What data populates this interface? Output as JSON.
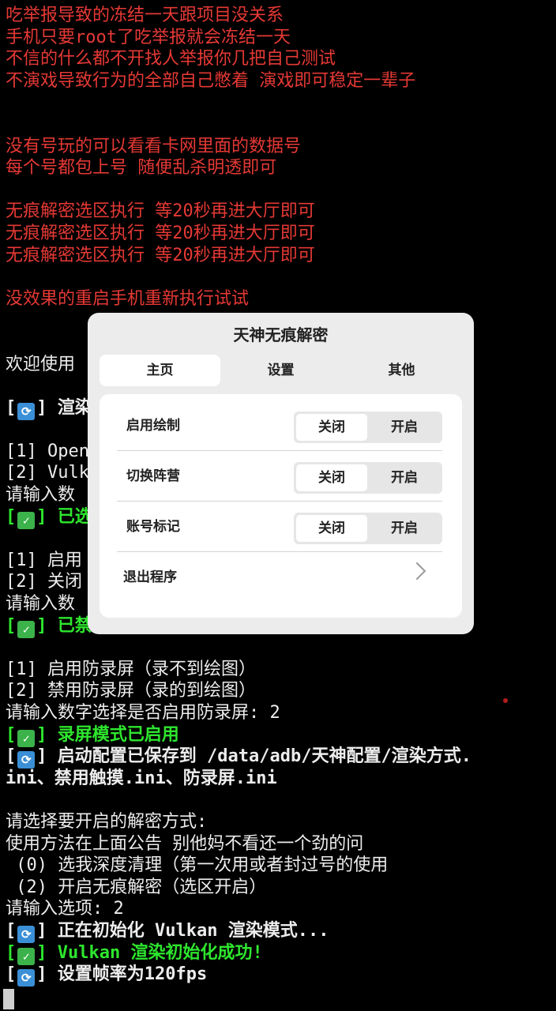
{
  "terminal": {
    "lines": [
      {
        "text": "吃举报导致的冻结一天跟项目没关系",
        "color": "red"
      },
      {
        "text": "手机只要root了吃举报就会冻结一天",
        "color": "red"
      },
      {
        "text": "不信的什么都不开找人举报你几把自己测试",
        "color": "red"
      },
      {
        "text": "不演戏导致行为的全部自己憋着 演戏即可稳定一辈子",
        "color": "red"
      },
      {
        "text": "",
        "color": "red"
      },
      {
        "text": "",
        "color": "red"
      },
      {
        "text": "没有号玩的可以看看卡网里面的数据号",
        "color": "red"
      },
      {
        "text": "每个号都包上号 随便乱杀明透即可",
        "color": "red"
      },
      {
        "text": "",
        "color": "red"
      },
      {
        "text": "无痕解密选区执行 等20秒再进大厅即可",
        "color": "red"
      },
      {
        "text": "无痕解密选区执行 等20秒再进大厅即可",
        "color": "red"
      },
      {
        "text": "无痕解密选区执行 等20秒再进大厅即可",
        "color": "red"
      },
      {
        "text": "",
        "color": "red"
      },
      {
        "text": "没效果的重启手机重新执行试试",
        "color": "red"
      },
      {
        "text": "",
        "color": "white"
      },
      {
        "text": "",
        "color": "white"
      },
      {
        "text": "欢迎使用",
        "color": "white"
      },
      {
        "text": "",
        "color": "white"
      },
      {
        "text": " 渲染",
        "color": "white",
        "bold": true,
        "icon": "refresh-icon"
      },
      {
        "text": "",
        "color": "white"
      },
      {
        "text": "[1] Open",
        "color": "white"
      },
      {
        "text": "[2] Vulk",
        "color": "white"
      },
      {
        "text": "请输入数",
        "color": "white"
      },
      {
        "text": " 已选",
        "color": "green",
        "icon": "check-icon"
      },
      {
        "text": "",
        "color": "white"
      },
      {
        "text": "[1] 启用",
        "color": "white"
      },
      {
        "text": "[2] 关闭",
        "color": "white"
      },
      {
        "text": "请输入数",
        "color": "white"
      },
      {
        "text": " 已禁用触摸模式",
        "color": "green",
        "icon": "check-icon"
      },
      {
        "text": "",
        "color": "white"
      },
      {
        "text": "[1] 启用防录屏（录不到绘图）",
        "color": "white"
      },
      {
        "text": "[2] 禁用防录屏（录的到绘图）",
        "color": "white"
      },
      {
        "text": "请输入数字选择是否启用防录屏: 2",
        "color": "white"
      },
      {
        "text": " 录屏模式已启用",
        "color": "green",
        "icon": "check-icon"
      },
      {
        "text": " 启动配置已保存到 /data/adb/天神配置/渲染方式.",
        "color": "white",
        "bold": true,
        "icon": "refresh-icon"
      },
      {
        "text": "ini、禁用触摸.ini、防录屏.ini",
        "color": "white",
        "bold": true
      },
      {
        "text": "",
        "color": "white"
      },
      {
        "text": "请选择要开启的解密方式:",
        "color": "white"
      },
      {
        "text": "使用方法在上面公告 别他妈不看还一个劲的问",
        "color": "white"
      },
      {
        "text": " (0) 选我深度清理（第一次用或者封过号的使用",
        "color": "white"
      },
      {
        "text": " (2) 开启无痕解密（选区开启）",
        "color": "white"
      },
      {
        "text": "请输入选项: 2",
        "color": "white"
      },
      {
        "text": " 正在初始化 Vulkan 渲染模式...",
        "color": "white",
        "bold": true,
        "icon": "refresh-icon"
      },
      {
        "text": " Vulkan 渲染初始化成功!",
        "color": "green",
        "icon": "check-icon"
      },
      {
        "text": " 设置帧率为120fps",
        "color": "white",
        "bold": true,
        "icon": "refresh-icon"
      }
    ]
  },
  "dialog": {
    "title": "天神无痕解密",
    "tabs": [
      {
        "label": "主页",
        "active": true
      },
      {
        "label": "设置",
        "active": false
      },
      {
        "label": "其他",
        "active": false
      }
    ],
    "settings": [
      {
        "label": "启用绘制",
        "off_label": "关闭",
        "on_label": "开启",
        "value": "关闭"
      },
      {
        "label": "切换阵营",
        "off_label": "关闭",
        "on_label": "开启",
        "value": "关闭"
      },
      {
        "label": "账号标记",
        "off_label": "关闭",
        "on_label": "开启",
        "value": "关闭"
      }
    ],
    "exit_label": "退出程序"
  },
  "colors": {
    "red": "#e53935",
    "green": "#2ee62e",
    "terminal_bg": "#000000",
    "dialog_bg": "#ececec"
  }
}
